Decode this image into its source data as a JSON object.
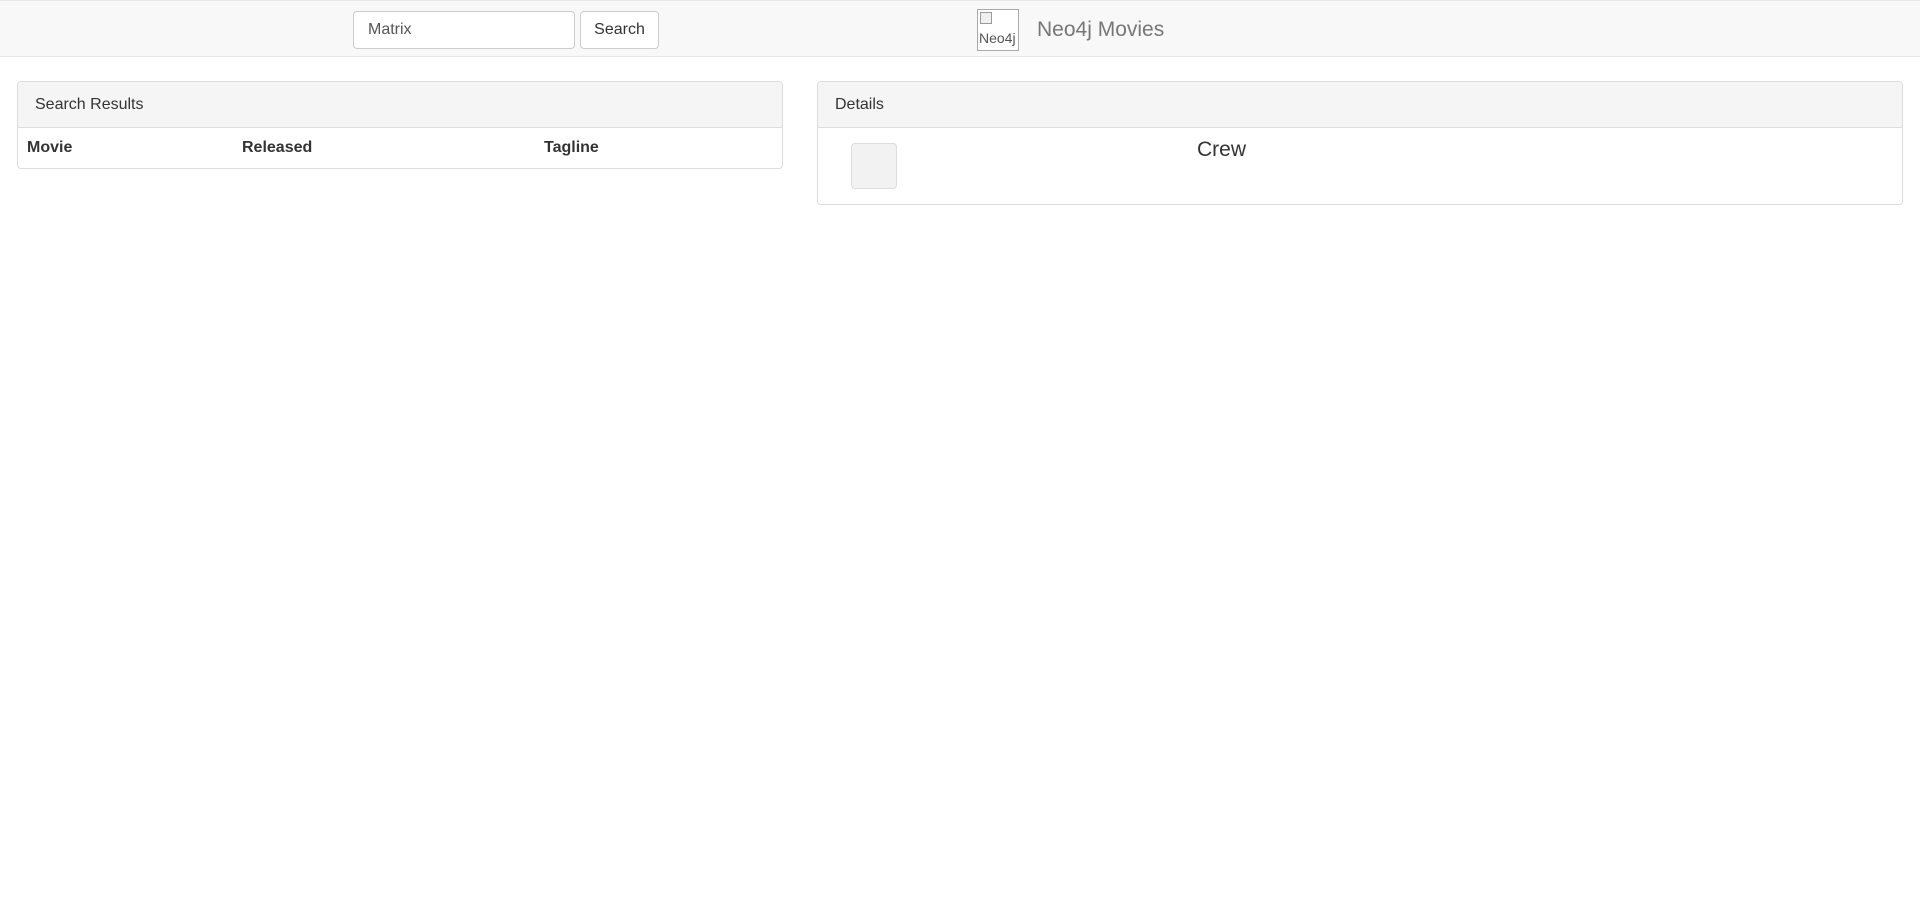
{
  "navbar": {
    "search": {
      "value": "Matrix",
      "placeholder": ""
    },
    "search_button_label": "Search",
    "brand": {
      "logo_alt": "Neo4j",
      "name": "Neo4j Movies"
    }
  },
  "results_panel": {
    "heading": "Search Results",
    "columns": [
      "Movie",
      "Released",
      "Tagline"
    ]
  },
  "details_panel": {
    "heading": "Details",
    "crew_title": "Crew"
  },
  "colors": {
    "navbar_bg": "#f8f8f8",
    "panel_heading_bg": "#f5f5f5",
    "border": "#dddddd",
    "brand_text": "#777777"
  }
}
